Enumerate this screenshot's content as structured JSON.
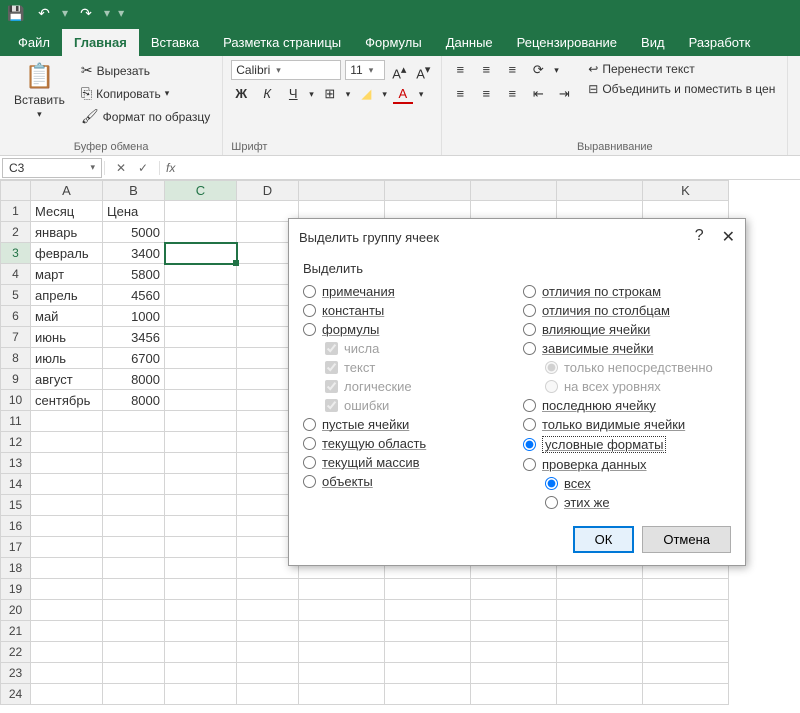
{
  "titlebar": {
    "save_icon": "💾",
    "undo_icon": "↶",
    "redo_icon": "↷"
  },
  "tabs": {
    "file": "Файл",
    "home": "Главная",
    "insert": "Вставка",
    "layout": "Разметка страницы",
    "formulas": "Формулы",
    "data": "Данные",
    "review": "Рецензирование",
    "view": "Вид",
    "developer": "Разработк"
  },
  "ribbon": {
    "clipboard": {
      "paste": "Вставить",
      "cut": "Вырезать",
      "copy": "Копировать",
      "format_painter": "Формат по образцу",
      "label": "Буфер обмена"
    },
    "font": {
      "family": "Calibri",
      "size": "11",
      "bold": "Ж",
      "italic": "К",
      "underline": "Ч",
      "label": "Шрифт"
    },
    "align": {
      "wrap": "Перенести текст",
      "merge": "Объединить и поместить в цен",
      "label": "Выравнивание"
    }
  },
  "formula": {
    "cell_ref": "C3",
    "fx": "fx"
  },
  "columns": [
    "A",
    "B",
    "C",
    "D",
    "",
    "",
    "",
    "",
    "K"
  ],
  "grid_visible_rows": 24,
  "chart_data": {
    "type": "table",
    "headers": [
      "Месяц",
      "Цена"
    ],
    "rows": [
      [
        "январь",
        5000
      ],
      [
        "февраль",
        3400
      ],
      [
        "март",
        5800
      ],
      [
        "апрель",
        4560
      ],
      [
        "май",
        1000
      ],
      [
        "июнь",
        3456
      ],
      [
        "июль",
        6700
      ],
      [
        "август",
        8000
      ],
      [
        "сентябрь",
        8000
      ]
    ]
  },
  "dialog": {
    "title": "Выделить группу ячеек",
    "help": "?",
    "close": "✕",
    "select_label": "Выделить",
    "left": {
      "comments": "примечания",
      "constants": "константы",
      "formulas": "формулы",
      "numbers": "числа",
      "text": "текст",
      "logical": "логические",
      "errors": "ошибки",
      "blanks": "пустые ячейки",
      "current_region": "текущую область",
      "current_array": "текущий массив",
      "objects": "объекты"
    },
    "right": {
      "row_diffs": "отличия по строкам",
      "col_diffs": "отличия по столбцам",
      "precedents": "влияющие ячейки",
      "dependents": "зависимые ячейки",
      "direct_only": "только непосредственно",
      "all_levels": "на всех уровнях",
      "last_cell": "последнюю ячейку",
      "visible_only": "только видимые ячейки",
      "cond_formats": "условные форматы",
      "data_validation": "проверка данных",
      "all": "всех",
      "same": "этих же"
    },
    "ok": "ОК",
    "cancel": "Отмена"
  }
}
